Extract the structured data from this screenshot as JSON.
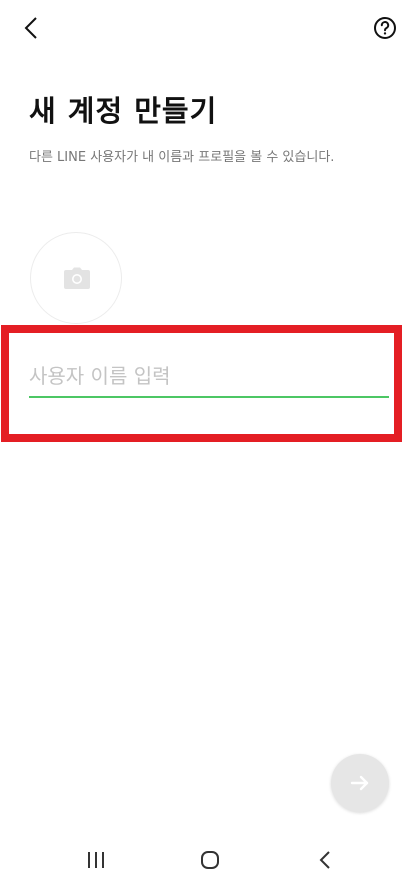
{
  "header": {
    "back_icon": "chevron-left-icon",
    "help_icon": "question-circle-icon"
  },
  "page": {
    "title": "새 계정 만들기",
    "subtitle": "다른 LINE 사용자가 내 이름과 프로필을 볼 수 있습니다."
  },
  "profile_photo": {
    "icon": "camera-icon"
  },
  "name_input": {
    "value": "",
    "placeholder": "사용자 이름 입력"
  },
  "next_button": {
    "icon": "arrow-right-icon"
  },
  "system_nav": {
    "recent_icon": "recent-apps-icon",
    "home_icon": "home-icon",
    "back_icon": "back-icon"
  },
  "colors": {
    "accent_green": "#4cc764",
    "highlight_red": "#e41e24",
    "placeholder_gray": "#c4c4c4"
  }
}
